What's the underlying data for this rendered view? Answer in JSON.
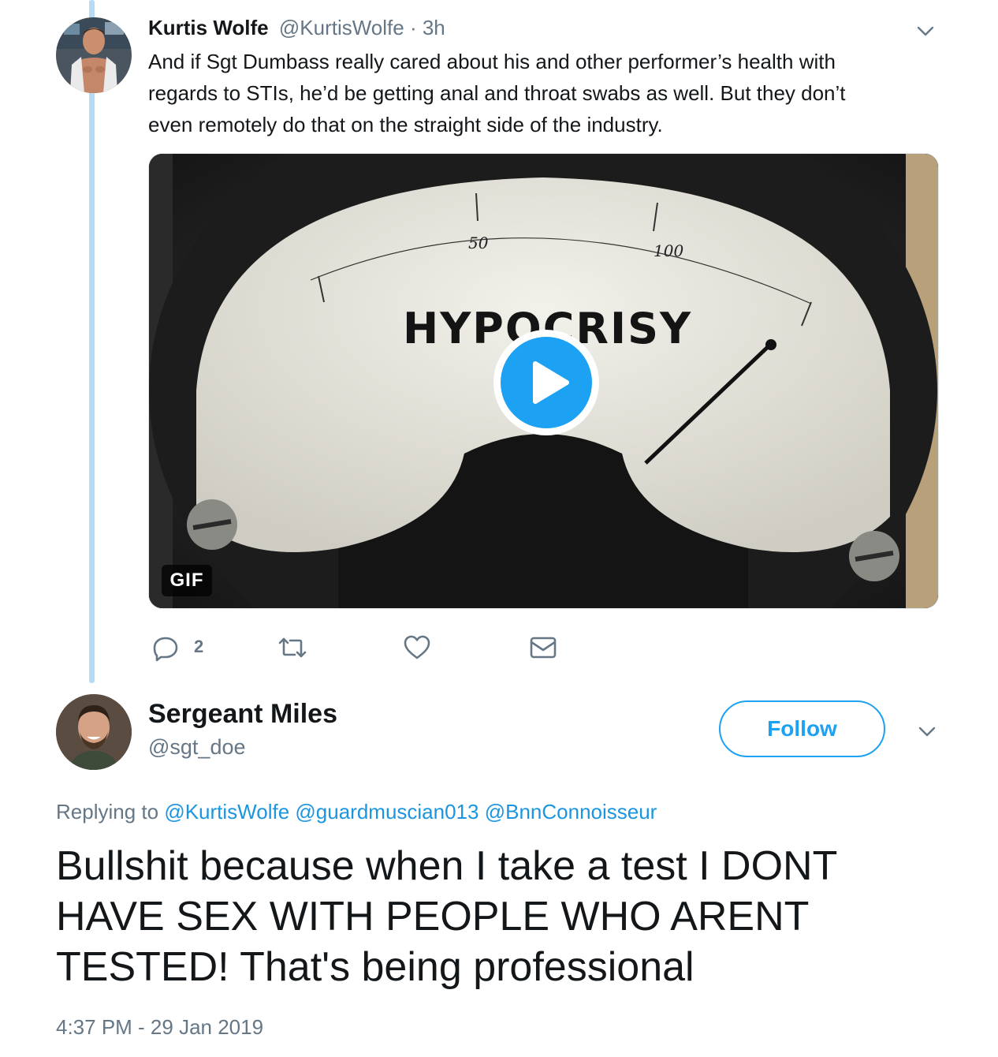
{
  "first_tweet": {
    "display_name": "Kurtis Wolfe",
    "handle": "@KurtisWolfe",
    "separator": " · ",
    "time_ago": "3h",
    "text_lines": [
      "And if Sgt Dumbass really cared about his and other performer’s health with",
      "regards to STIs, he’d be getting anal and throat swabs as well. But they don’t",
      "even remotely do that on the straight side of the industry."
    ],
    "media": {
      "gauge_label": "HYPOCRISY",
      "scale_50": "50",
      "scale_100": "100",
      "badge": "GIF",
      "play_icon": "play-icon"
    },
    "actions": {
      "reply_count": "2",
      "icons": [
        "reply-icon",
        "retweet-icon",
        "like-icon",
        "message-icon"
      ]
    }
  },
  "second_tweet": {
    "display_name": "Sergeant Miles",
    "handle": "@sgt_doe",
    "follow_label": "Follow",
    "replying_prefix": "Replying to ",
    "mentions": [
      "@KurtisWolfe",
      "@guardmuscian013",
      "@BnnConnoisseur"
    ],
    "text_lines": [
      "Bullshit because when I take a test I DONT",
      "HAVE SEX WITH PEOPLE WHO ARENT",
      "TESTED! That's being professional"
    ],
    "timestamp": "4:37 PM - 29 Jan 2019"
  },
  "colors": {
    "accent": "#1da1f2",
    "thread_line": "#b5dcf7",
    "muted": "#657786"
  }
}
